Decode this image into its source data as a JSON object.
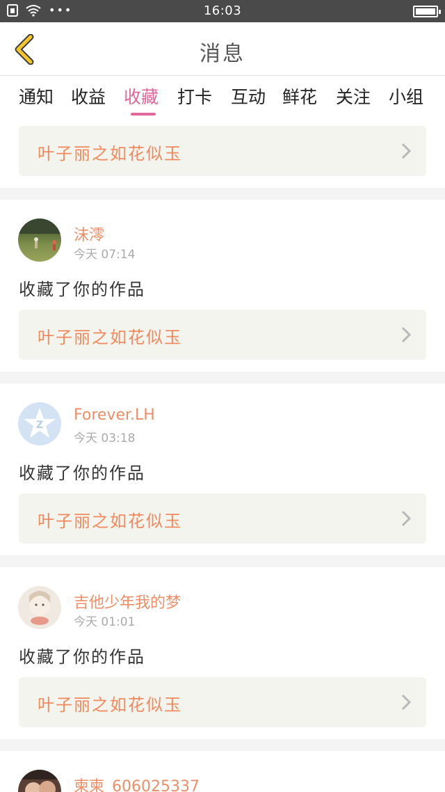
{
  "status_bar": {
    "time": "16:03",
    "dots": "•••"
  },
  "header": {
    "title": "消息"
  },
  "tabs": [
    {
      "label": "通知"
    },
    {
      "label": "收益"
    },
    {
      "label": "收藏"
    },
    {
      "label": "打卡"
    },
    {
      "label": "互动"
    },
    {
      "label": "鲜花"
    },
    {
      "label": "关注"
    },
    {
      "label": "小组"
    }
  ],
  "active_tab": "收藏",
  "first_item": {
    "work_title": "叶子丽之如花似玉"
  },
  "items": [
    {
      "username": "沫澪",
      "time": "今天 07:14",
      "message": "收藏了你的作品",
      "work_title": "叶子丽之如花似玉"
    },
    {
      "username": "Forever.LH",
      "time": "今天 03:18",
      "message": "收藏了你的作品",
      "work_title": "叶子丽之如花似玉"
    },
    {
      "username": "吉他少年我的梦",
      "time": "今天 01:01",
      "message": "收藏了你的作品",
      "work_title": "叶子丽之如花似玉"
    },
    {
      "username": "柬柬_606025337"
    }
  ],
  "colors": {
    "accent": "#e0679a",
    "link_text": "#f0895d",
    "username": "#ec8e67",
    "back_arrow": "#f2c531"
  }
}
